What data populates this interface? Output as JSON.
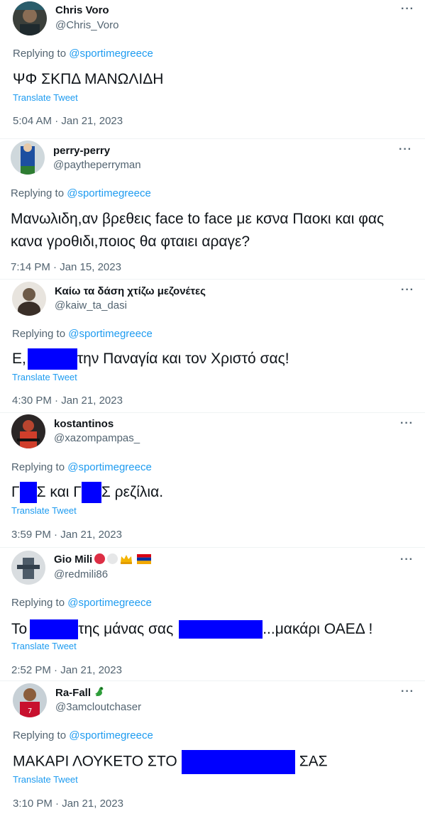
{
  "common": {
    "replying_to": "Replying to",
    "mention": "@sportimegreece",
    "translate": "Translate Tweet",
    "more": "···"
  },
  "tweets": [
    {
      "name": "Chris Voro",
      "handle": "@Chris_Voro",
      "text": "ΨΦ ΣΚΠΔ ΜΑΝΩΛΙΔΗ",
      "time": "5:04 AM · Jan 21, 2023"
    },
    {
      "name": "perry-perry",
      "handle": "@paytheperryman",
      "text": "Μανωλιδη,αν βρεθεις face to face με κσνα Παοκι και φας κανα γροθιδι,ποιος θα φταιει αραγε?",
      "time": "7:14 PM · Jan 15, 2023"
    },
    {
      "name": "Καίω τα δάση χτίζω μεζονέτες",
      "handle": "@kaiw_ta_dasi",
      "text_before": "Ε,",
      "text_after": "την Παναγία και τον Χριστό σας!",
      "time": "4:30 PM · Jan 21, 2023"
    },
    {
      "name": "kostantinos",
      "handle": "@xazompampas_",
      "text_part1": "Γ",
      "text_part2": "Σ και Γ",
      "text_part3": "Σ ρεζίλια.",
      "time": "3:59 PM · Jan 21, 2023"
    },
    {
      "name": "Gio Mili",
      "handle": "@redmili86",
      "text_part1": "Το",
      "text_part2": "της μάνας σας",
      "text_part3": "...μακάρι ΟΑΕΔ !",
      "time": "2:52 PM · Jan 21, 2023"
    },
    {
      "name": "Ra-Fall",
      "handle": "@3amcloutchaser",
      "text_before": "ΜΑΚΑΡΙ ΛΟΥΚΕΤΟ ΣΤΟ",
      "text_after": "ΣΑΣ",
      "time": "3:10 PM · Jan 21, 2023"
    }
  ],
  "colors": {
    "accent": "#1d9bf0",
    "secondary_text": "#536471",
    "redaction": "#0000ff"
  },
  "icons": {
    "more": "more-icon",
    "badge_red": "red-circle-icon",
    "badge_white": "white-circle-icon",
    "badge_crown": "crown-icon",
    "badge_flag": "flag-icon",
    "emoji_dino": "dinosaur-icon"
  }
}
